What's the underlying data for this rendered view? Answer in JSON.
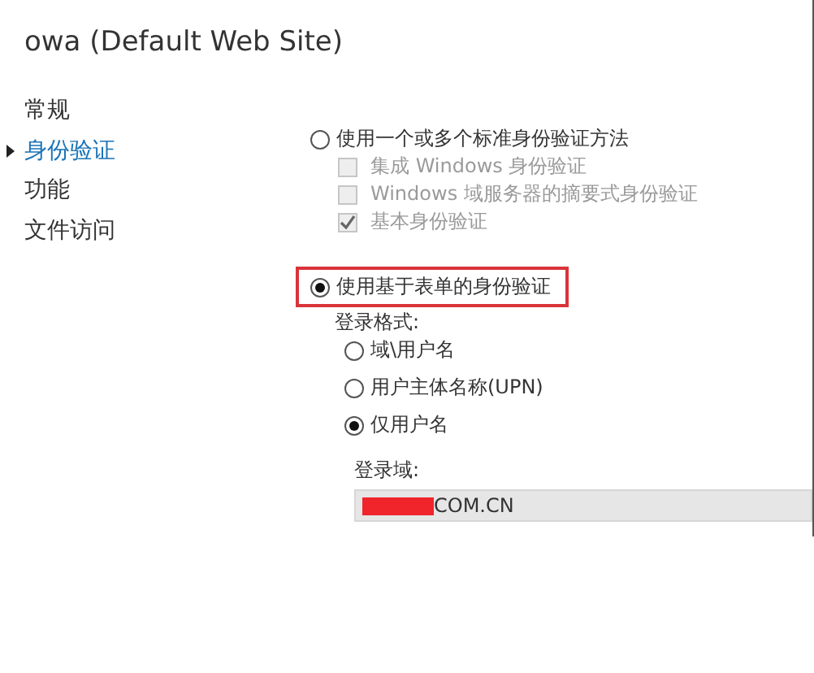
{
  "title": "owa (Default Web Site)",
  "sidebar": {
    "items": [
      {
        "label": "常规",
        "selected": false
      },
      {
        "label": "身份验证",
        "selected": true
      },
      {
        "label": "功能",
        "selected": false
      },
      {
        "label": "文件访问",
        "selected": false
      }
    ]
  },
  "auth_methods": [
    {
      "label": "使用一个或多个标准身份验证方法",
      "selected": false,
      "highlighted": false,
      "options": [
        {
          "label": "集成 Windows 身份验证",
          "checked": false,
          "disabled": true
        },
        {
          "label": "Windows 域服务器的摘要式身份验证",
          "checked": false,
          "disabled": true
        },
        {
          "label": "基本身份验证",
          "checked": true,
          "disabled": true
        }
      ]
    },
    {
      "label": "使用基于表单的身份验证",
      "selected": true,
      "highlighted": true
    }
  ],
  "login_format": {
    "label": "登录格式:",
    "options": [
      {
        "label": "域\\用户名",
        "selected": false
      },
      {
        "label": "用户主体名称(UPN)",
        "selected": false
      },
      {
        "label": "仅用户名",
        "selected": true
      }
    ]
  },
  "login_domain": {
    "label": "登录域:",
    "value": "COM.CN",
    "redacted": true
  }
}
